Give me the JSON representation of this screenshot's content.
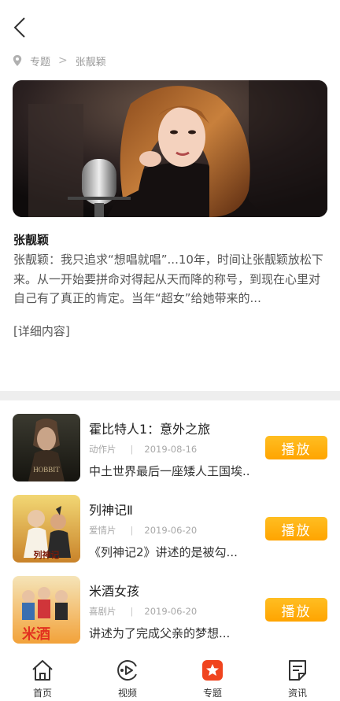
{
  "breadcrumb": {
    "parent": "专题",
    "separator": ">",
    "current": "张靓颖"
  },
  "artist": {
    "name": "张靓颖",
    "description": "张靓颖：我只追求“想唱就唱”...10年，时间让张靓颖放松下来。从一开始要拼命对得起从天而降的称号，到现在心里对自己有了真正的肯定。当年“超女”给她带来的...",
    "detail_link": "[详细内容]"
  },
  "movies": [
    {
      "title": "霍比特人1：意外之旅",
      "genre": "动作片",
      "date": "2019-08-16",
      "summary": "中土世界最后一座矮人王国埃...",
      "play_label": "播放",
      "poster_icon": "hobbit-poster"
    },
    {
      "title": "列神记Ⅱ",
      "genre": "爱情片",
      "date": "2019-06-20",
      "summary": "《列神记2》讲述的是被勾...",
      "play_label": "播放",
      "poster_icon": "liesheng-poster"
    },
    {
      "title": "米酒女孩",
      "genre": "喜剧片",
      "date": "2019-06-20",
      "summary": "讲述为了完成父亲的梦想...",
      "play_label": "播放",
      "poster_icon": "rice-wine-poster"
    }
  ],
  "tabs": [
    {
      "label": "首页",
      "icon": "home-icon"
    },
    {
      "label": "视频",
      "icon": "video-icon"
    },
    {
      "label": "专题",
      "icon": "topic-star-icon"
    },
    {
      "label": "资讯",
      "icon": "news-icon"
    }
  ],
  "colors": {
    "accent_orange": "#ffa400",
    "topic_red": "#f0441e",
    "divider": "#eeeeee"
  }
}
